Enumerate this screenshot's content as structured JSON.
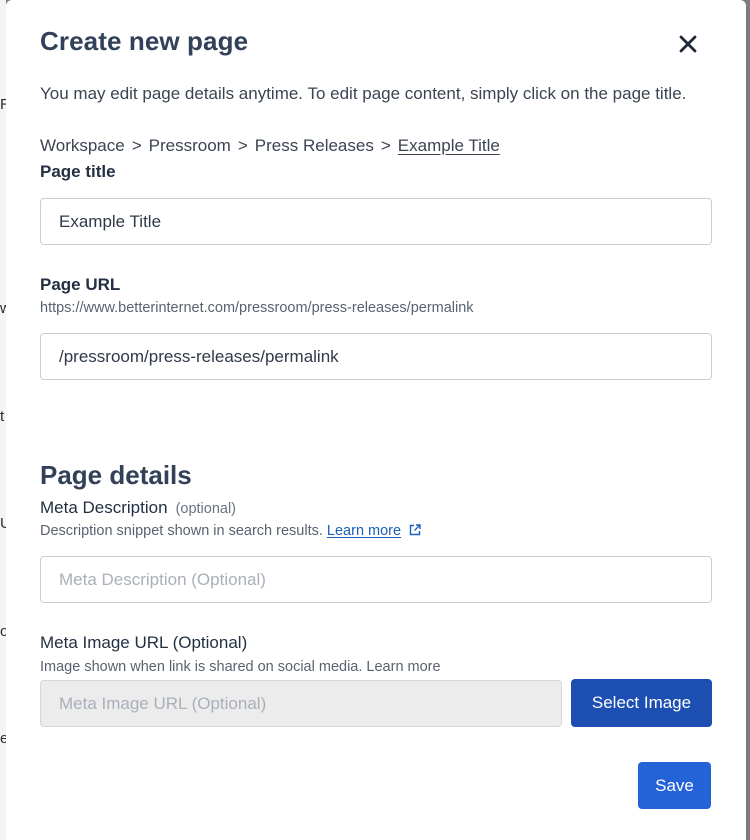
{
  "dialog": {
    "title": "Create new page",
    "intro": "You may edit page details anytime. To edit page content, simply click on the page title.",
    "close_icon": "close-icon"
  },
  "breadcrumb": {
    "items": [
      "Workspace",
      "Pressroom",
      "Press Releases"
    ],
    "separator": ">",
    "current": "Example Title"
  },
  "page_title": {
    "label": "Page title",
    "value": "Example Title"
  },
  "page_url": {
    "label": "Page URL",
    "help": "https://www.betterinternet.com/pressroom/press-releases/permalink",
    "value": "/pressroom/press-releases/permalink"
  },
  "details": {
    "title": "Page details",
    "meta_description": {
      "label": "Meta Description",
      "optional": "(optional)",
      "help": "Description snippet shown in search results.",
      "learn_more": "Learn more",
      "learn_more_icon": "external-link-icon",
      "placeholder": "Meta Description (Optional)"
    },
    "meta_image": {
      "label": "Meta Image URL (Optional)",
      "help": "Image shown when link is shared on social media. Learn more",
      "placeholder": "Meta Image URL (Optional)",
      "select_label": "Select Image"
    }
  },
  "footer": {
    "save_label": "Save"
  },
  "background": {
    "fragments": [
      "R",
      "w",
      "t",
      "U",
      "o",
      "e"
    ]
  },
  "colors": {
    "primary_button": "#1c4fb1",
    "save_button": "#2462d8",
    "heading": "#324159",
    "link": "#1b5fb9"
  }
}
